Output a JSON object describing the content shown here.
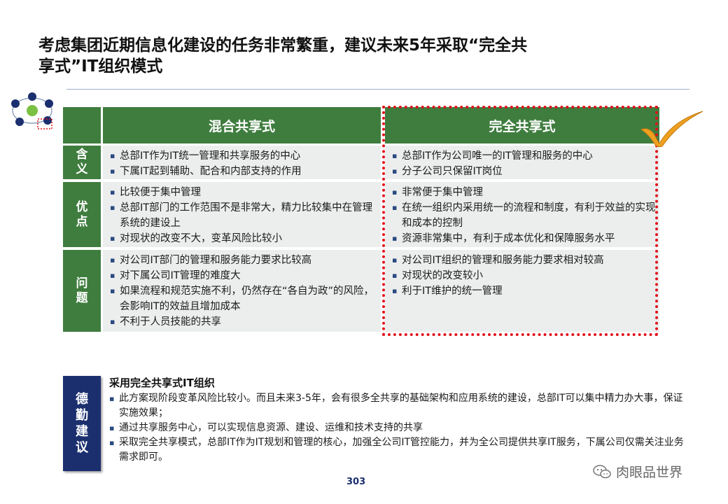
{
  "title": {
    "line1": "考虑集团近期信息化建设的任务非常繁重，建议未来5年采取“完全共",
    "line2": "享式”IT组织模式"
  },
  "table": {
    "columns": [
      "混合共享式",
      "完全共享式"
    ],
    "rows": [
      {
        "label": "含\n义",
        "mixed": [
          "总部IT作为IT统一管理和共享服务的中心",
          "下属IT起到辅助、配合和内部支持的作用"
        ],
        "full": [
          "总部IT作为公司唯一的IT管理和服务的中心",
          "分子公司只保留IT岗位"
        ]
      },
      {
        "label": "优\n点",
        "mixed": [
          "比较便于集中管理",
          "总部IT部门的工作范围不是非常大，精力比较集中在管理系统的建设上",
          "对现状的改变不大，变革风险比较小"
        ],
        "full": [
          "非常便于集中管理",
          "在统一组织内采用统一的流程和制度，有利于效益的实现和成本的控制",
          "资源非常集中，有利于成本优化和保障服务水平"
        ]
      },
      {
        "label": "问\n题",
        "mixed": [
          "对公司IT部门的管理和服务能力要求比较高",
          "对下属公司IT管理的难度大",
          "如果流程和规范实施不利，仍然存在“各自为政”的风险，会影响IT的效益且增加成本",
          "不利于人员技能的共享"
        ],
        "full": [
          "对公司IT组织的管理和服务能力要求相对较高",
          "对现状的改变较小",
          "利于IT维护的统一管理"
        ]
      }
    ]
  },
  "recommendation": {
    "label": "德\n勤\n建\n议",
    "title": "采用完全共享式IT组织",
    "items": [
      "此方案现阶段变革风险比较小。而且未来3-5年，会有很多全共享的基础架构和应用系统的建设，总部IT可以集中精力办大事，保证实施效果；",
      "通过共享服务中心，可以实现信息资源、建设、运维和技术支持的共享",
      "采取完全共享模式，总部IT作为IT规划和管理的核心，加强全公司IT管控能力，并为全公司提供共享IT服务，下属公司仅需关注业务需求即可。"
    ]
  },
  "page_number": "303",
  "watermark": "肉眼品世界",
  "colors": {
    "green": "#3f7d3f",
    "navy": "#1b2f6e",
    "red": "#e0101a",
    "check": "#f0a020"
  }
}
